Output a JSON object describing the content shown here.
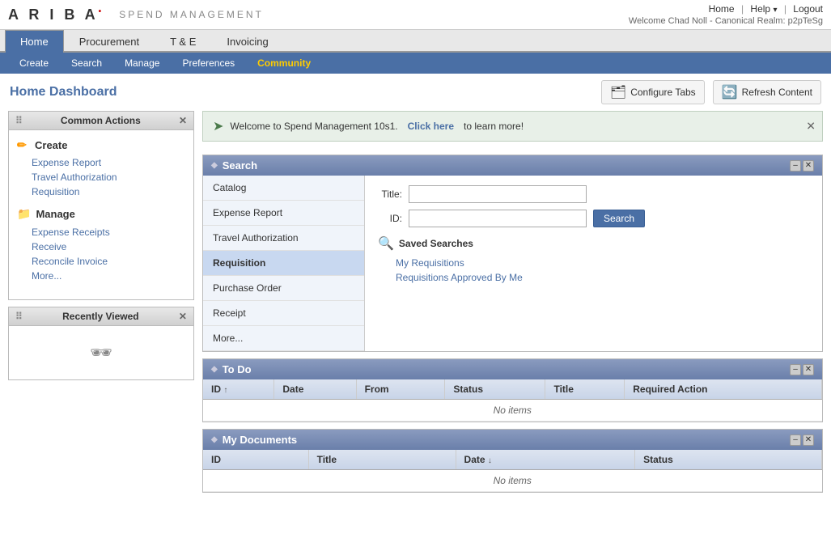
{
  "app": {
    "logo_ariba": "ARIBA",
    "logo_bullet": "•",
    "logo_title": "SPEND MANAGEMENT"
  },
  "top_links": {
    "home": "Home",
    "help": "Help",
    "help_arrow": "▾",
    "logout": "Logout",
    "welcome": "Welcome Chad Noll - Canonical Realm: p2pTeSg"
  },
  "nav": {
    "tabs": [
      {
        "id": "home",
        "label": "Home",
        "active": true
      },
      {
        "id": "procurement",
        "label": "Procurement",
        "active": false
      },
      {
        "id": "te",
        "label": "T & E",
        "active": false
      },
      {
        "id": "invoicing",
        "label": "Invoicing",
        "active": false
      }
    ],
    "sub_items": [
      {
        "id": "create",
        "label": "Create"
      },
      {
        "id": "search",
        "label": "Search"
      },
      {
        "id": "manage",
        "label": "Manage"
      },
      {
        "id": "preferences",
        "label": "Preferences"
      },
      {
        "id": "community",
        "label": "Community",
        "highlight": true
      }
    ]
  },
  "page_header": {
    "title": "Home",
    "title_colored": "Dashboard",
    "configure_tabs": "Configure Tabs",
    "refresh_content": "Refresh Content"
  },
  "welcome_banner": {
    "arrow": "➤",
    "text": "Welcome to Spend Management 10s1.",
    "link_text": "Click here",
    "after_text": "to learn more!"
  },
  "common_actions": {
    "title": "Common Actions",
    "create_label": "Create",
    "create_links": [
      {
        "label": "Expense Report"
      },
      {
        "label": "Travel Authorization"
      },
      {
        "label": "Requisition"
      }
    ],
    "manage_label": "Manage",
    "manage_links": [
      {
        "label": "Expense Receipts"
      },
      {
        "label": "Receive"
      },
      {
        "label": "Reconcile Invoice"
      },
      {
        "label": "More..."
      }
    ]
  },
  "recently_viewed": {
    "title": "Recently Viewed",
    "glasses_char": "👓"
  },
  "search": {
    "title": "Search",
    "left_items": [
      {
        "id": "catalog",
        "label": "Catalog"
      },
      {
        "id": "expense-report",
        "label": "Expense Report"
      },
      {
        "id": "travel-auth",
        "label": "Travel Authorization"
      },
      {
        "id": "requisition",
        "label": "Requisition",
        "active": true
      },
      {
        "id": "purchase-order",
        "label": "Purchase Order"
      },
      {
        "id": "receipt",
        "label": "Receipt"
      },
      {
        "id": "more",
        "label": "More..."
      }
    ],
    "title_label": "Title:",
    "id_label": "ID:",
    "search_button": "Search",
    "saved_searches_title": "Saved Searches",
    "saved_searches": [
      {
        "label": "My Requisitions"
      },
      {
        "label": "Requisitions Approved By Me"
      }
    ]
  },
  "todo": {
    "title": "To Do",
    "columns": [
      {
        "label": "ID",
        "sort": "↑"
      },
      {
        "label": "Date",
        "sort": ""
      },
      {
        "label": "From",
        "sort": ""
      },
      {
        "label": "Status",
        "sort": ""
      },
      {
        "label": "Title",
        "sort": ""
      },
      {
        "label": "Required Action",
        "sort": ""
      }
    ],
    "empty_message": "No items"
  },
  "my_documents": {
    "title": "My Documents",
    "columns": [
      {
        "label": "ID",
        "sort": ""
      },
      {
        "label": "Title",
        "sort": ""
      },
      {
        "label": "Date",
        "sort": "↓"
      },
      {
        "label": "Status",
        "sort": ""
      }
    ],
    "empty_message": "No items"
  }
}
